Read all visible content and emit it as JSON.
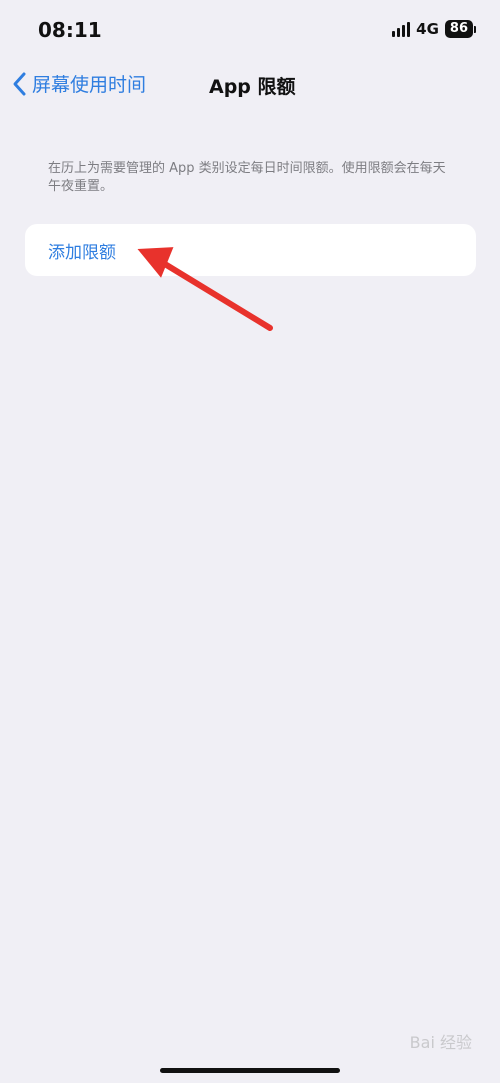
{
  "status_bar": {
    "time": "08:11",
    "network": "4G",
    "battery": "86"
  },
  "nav": {
    "back_label": "屏幕使用时间",
    "title": "App 限额"
  },
  "description": "在历上为需要管理的 App 类别设定每日时间限额。使用限额会在每天午夜重置。",
  "add_limit_label": "添加限额",
  "watermark": "Bai 经验",
  "colors": {
    "background": "#f0eff5",
    "accent": "#2f7ee0",
    "annotation_arrow": "#e8322c"
  },
  "icons": {
    "signal": "signal-bars-icon",
    "back": "chevron-left-icon",
    "battery": "battery-icon",
    "annotation": "red-arrow-icon"
  }
}
